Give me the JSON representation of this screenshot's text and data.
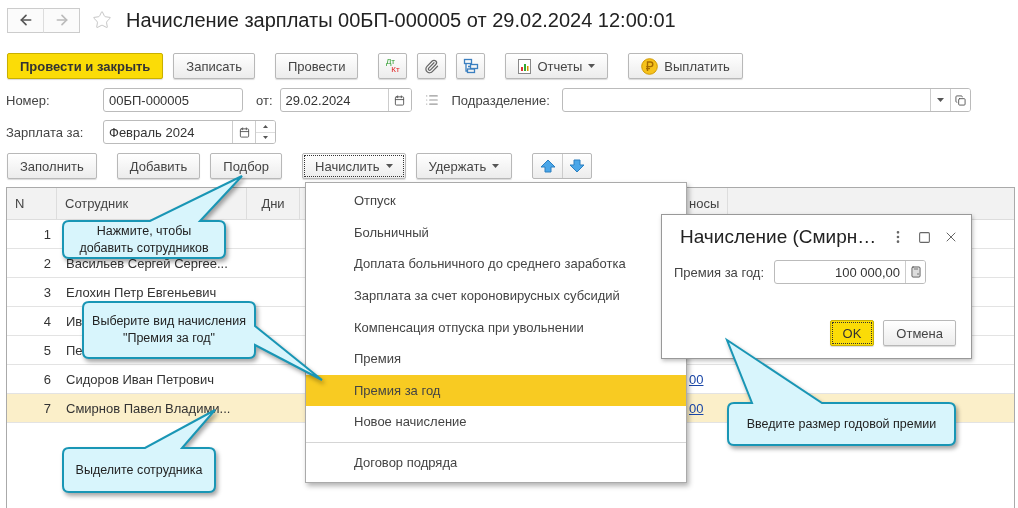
{
  "window": {
    "title": "Начисление зарплаты 00БП-000005 от 29.02.2024 12:00:01",
    "favorite": false
  },
  "toolbar": [
    {
      "kind": "primary",
      "label": "Провести и закрыть"
    },
    {
      "kind": "plain",
      "label": "Записать"
    },
    {
      "kind": "plain",
      "label": "Провести"
    },
    {
      "kind": "dtkt",
      "debit": "Дт",
      "credit": "Кт"
    },
    {
      "kind": "clip"
    },
    {
      "kind": "tree"
    },
    {
      "kind": "report",
      "label": "Отчеты"
    },
    {
      "kind": "coin",
      "label": "Выплатить"
    }
  ],
  "form": {
    "number": {
      "label": "Номер:",
      "value": "00БП-000005"
    },
    "date": {
      "label": "от:",
      "value": "29.02.2024"
    },
    "department": {
      "label": "Подразделение:"
    },
    "period": {
      "label": "Зарплата за:",
      "value": "Февраль 2024"
    }
  },
  "table_toolbar": [
    {
      "kind": "plain",
      "label": "Заполнить"
    },
    {
      "kind": "plain",
      "label": "Добавить"
    },
    {
      "kind": "plain",
      "label": "Подбор"
    },
    {
      "kind": "menu",
      "label": "Начислить",
      "expanded": true
    },
    {
      "kind": "menu",
      "label": "Удержать",
      "expanded": false
    },
    {
      "kind": "up"
    },
    {
      "kind": "down"
    }
  ],
  "table": {
    "columns": [
      {
        "label": "N"
      },
      {
        "label": "Сотрудник"
      },
      {
        "label": "Дни"
      },
      {
        "label": "носы"
      }
    ],
    "rows": [
      {
        "n": "1",
        "selected": false
      },
      {
        "n": "2",
        "employee": "Васильев Сергей Сергее...",
        "selected": false
      },
      {
        "n": "3",
        "employee": "Елохин Петр Евгеньевич",
        "selected": false
      },
      {
        "n": "4",
        "employee": "Ив",
        "selected": false
      },
      {
        "n": "5",
        "employee": "Пе",
        "selected": false
      },
      {
        "n": "6",
        "employee": "Сидоров Иван Петрович",
        "amount": "00",
        "selected": false
      },
      {
        "n": "7",
        "employee": "Смирнов Павел Владими...",
        "amount": "00",
        "selected": true
      }
    ]
  },
  "menu": {
    "groups": [
      [
        {
          "label": "Отпуск",
          "selected": false
        },
        {
          "label": "Больничный",
          "selected": false
        },
        {
          "label": "Доплата больничного до среднего заработка",
          "selected": false
        },
        {
          "label": "Зарплата за счет короновирусных субсидий",
          "selected": false
        },
        {
          "label": "Компенсация отпуска при увольнении",
          "selected": false
        },
        {
          "label": "Премия",
          "selected": false
        },
        {
          "label": "Премия за год",
          "selected": true
        },
        {
          "label": "Новое начисление",
          "selected": false
        }
      ],
      [
        {
          "label": "Договор подряда",
          "selected": false
        }
      ]
    ]
  },
  "dialog": {
    "title": "Начисление (Смирн…",
    "field": {
      "label": "Премия за год:",
      "value": "100 000,00"
    },
    "buttons": [
      {
        "kind": "primary",
        "label": "OK"
      },
      {
        "kind": "plain",
        "label": "Отмена"
      }
    ]
  },
  "callouts": [
    {
      "text": "Нажмите, чтобы добавить сотрудников"
    },
    {
      "text": "Выберите вид начисления \"Премия за год\""
    },
    {
      "text": "Выделите сотрудника"
    },
    {
      "text": "Введите размер годовой премии"
    }
  ]
}
